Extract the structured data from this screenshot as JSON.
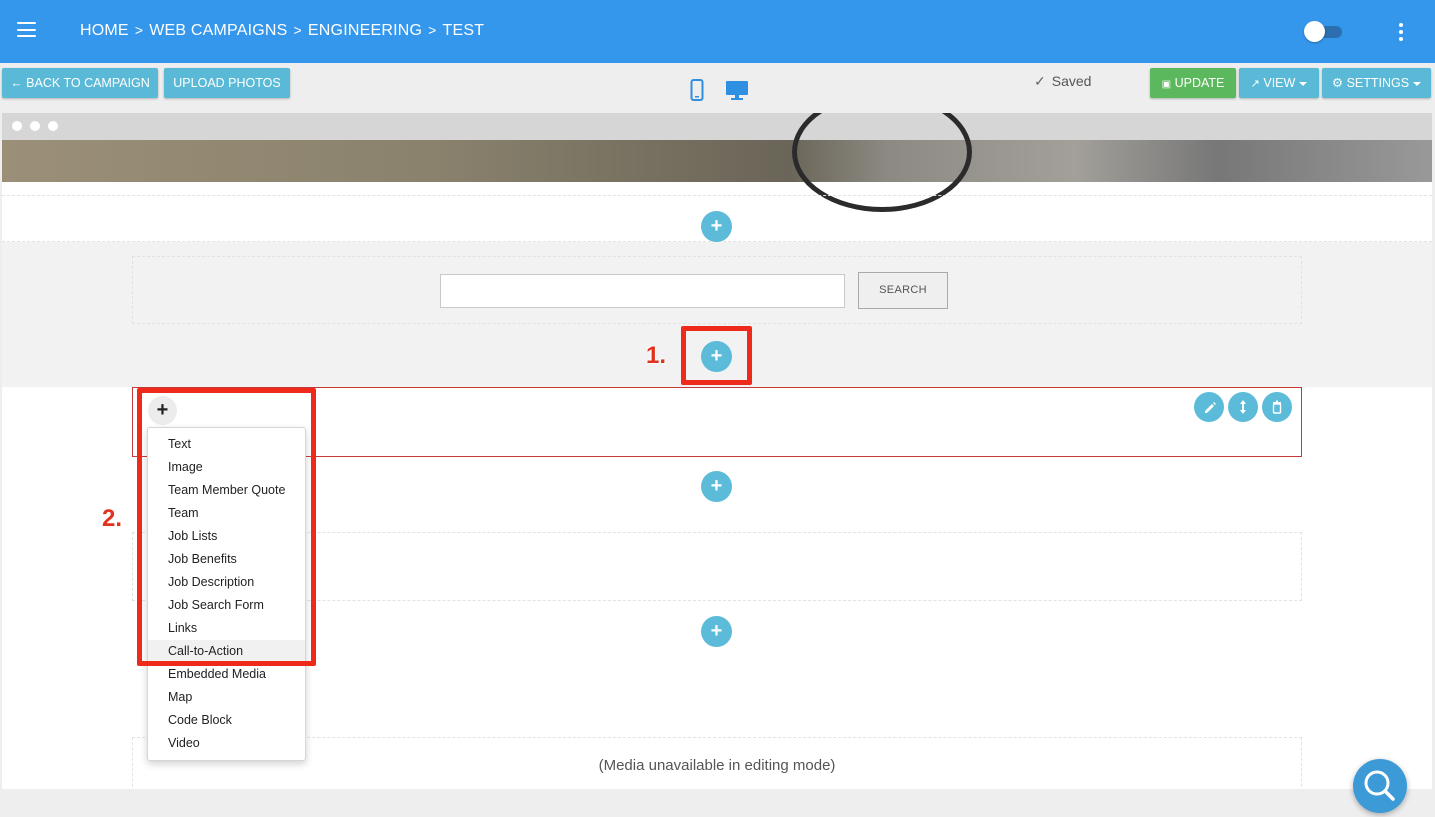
{
  "header": {
    "breadcrumb": [
      "HOME",
      "WEB CAMPAIGNS",
      "ENGINEERING",
      "TEST"
    ],
    "separator": ">"
  },
  "toolbar": {
    "back_label": "BACK TO CAMPAIGN",
    "upload_label": "UPLOAD PHOTOS",
    "saved_label": "Saved",
    "update_label": "UPDATE",
    "view_label": "VIEW",
    "settings_label": "SETTINGS"
  },
  "content": {
    "search_button": "SEARCH",
    "search_value": "",
    "media_notice": "(Media unavailable in editing mode)"
  },
  "annotations": {
    "step1": "1.",
    "step2": "2."
  },
  "add_menu": {
    "items": [
      "Text",
      "Image",
      "Team Member Quote",
      "Team",
      "Job Lists",
      "Job Benefits",
      "Job Description",
      "Job Search Form",
      "Links",
      "Call-to-Action",
      "Embedded Media",
      "Map",
      "Code Block",
      "Video"
    ],
    "hovered": "Call-to-Action"
  },
  "colors": {
    "topbar": "#3597ec",
    "accent_cyan": "#5bbbd8",
    "update_green": "#5cb85c",
    "annotation_red": "#ee2a1b"
  },
  "icons": [
    "menu-icon",
    "arrow-left-icon",
    "mobile-icon",
    "desktop-icon",
    "check-icon",
    "upload-icon",
    "external-link-icon",
    "gear-icon",
    "plus-icon",
    "pencil-icon",
    "resize-icon",
    "trash-icon",
    "search-icon",
    "kebab-icon"
  ]
}
